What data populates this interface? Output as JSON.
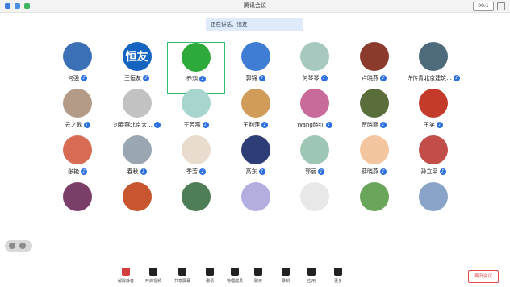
{
  "window": {
    "title": "腾讯会议",
    "timer": "00:1"
  },
  "banner": {
    "text": "正在讲话：恒友"
  },
  "participants": [
    {
      "name": "何强",
      "color": "#3b6fb6"
    },
    {
      "name": "王恒友",
      "color": "#1565c0",
      "avatar_text": "恒友"
    },
    {
      "name": "乔羽",
      "color": "#2eaa3b",
      "active": true
    },
    {
      "name": "郭锦",
      "color": "#3f7cd3"
    },
    {
      "name": "何琴琴",
      "color": "#a7c8bf"
    },
    {
      "name": "卢晓燕",
      "color": "#8b3b2b"
    },
    {
      "name": "许传青北京建筑...",
      "color": "#4d6b7a"
    },
    {
      "name": "云之歌",
      "color": "#b39b88"
    },
    {
      "name": "刘春燕北京大...",
      "color": "#c2c2c2"
    },
    {
      "name": "王芳燕",
      "color": "#a8d6cf"
    },
    {
      "name": "王利萍",
      "color": "#d19c5a"
    },
    {
      "name": "Wang晓红",
      "color": "#c86b9b"
    },
    {
      "name": "贾晓丽",
      "color": "#5a6e3c"
    },
    {
      "name": "王笑",
      "color": "#c43a2b"
    },
    {
      "name": "张艳",
      "color": "#d76b54"
    },
    {
      "name": "春秋",
      "color": "#9aa7b3"
    },
    {
      "name": "季芳",
      "color": "#e9dccf"
    },
    {
      "name": "高东",
      "color": "#2c3e75"
    },
    {
      "name": "郭丽",
      "color": "#9fc7b6"
    },
    {
      "name": "薛晓燕",
      "color": "#f4c6a0"
    },
    {
      "name": "孙立平",
      "color": "#c34d48"
    },
    {
      "name": "",
      "color": "#7a3f68"
    },
    {
      "name": "",
      "color": "#c7552d"
    },
    {
      "name": "",
      "color": "#4f7d57"
    },
    {
      "name": "",
      "color": "#b2aee0"
    },
    {
      "name": "",
      "color": "#e8e8e8"
    },
    {
      "name": "",
      "color": "#6aa55c"
    },
    {
      "name": "",
      "color": "#8aa3c8"
    }
  ],
  "toolbar": [
    {
      "label": "解除静音",
      "icon": "mic-muted-icon"
    },
    {
      "label": "开启视频",
      "icon": "video-off-icon"
    },
    {
      "label": "共享屏幕",
      "icon": "share-screen-icon"
    },
    {
      "label": "邀请",
      "icon": "invite-icon"
    },
    {
      "label": "管理成员",
      "icon": "members-icon"
    },
    {
      "label": "聊天",
      "icon": "chat-icon"
    },
    {
      "label": "录制",
      "icon": "record-icon"
    },
    {
      "label": "应用",
      "icon": "apps-icon"
    },
    {
      "label": "更多",
      "icon": "more-icon"
    }
  ],
  "end_button": {
    "label": "离开会议"
  }
}
